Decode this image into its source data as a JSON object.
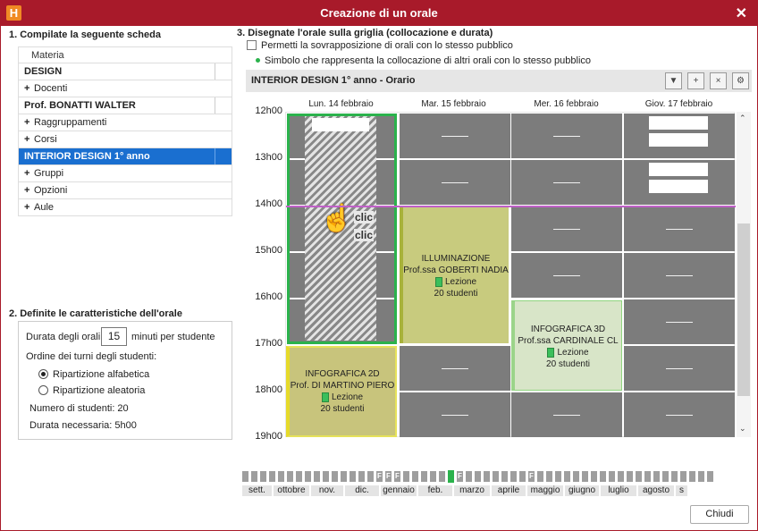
{
  "window": {
    "title": "Creazione di un orale",
    "app_icon": "H"
  },
  "section1": {
    "title": "1. Compilate la seguente scheda",
    "rows": [
      {
        "label": "Materia",
        "kind": "header"
      },
      {
        "label": "DESIGN",
        "kind": "value"
      },
      {
        "label": "Docenti",
        "kind": "group"
      },
      {
        "label": "Prof. BONATTI WALTER",
        "kind": "value"
      },
      {
        "label": "Raggruppamenti",
        "kind": "group"
      },
      {
        "label": "Corsi",
        "kind": "group"
      },
      {
        "label": "INTERIOR DESIGN  1° anno",
        "kind": "selected"
      },
      {
        "label": "Gruppi",
        "kind": "group"
      },
      {
        "label": "Opzioni",
        "kind": "group"
      },
      {
        "label": "Aule",
        "kind": "group"
      }
    ]
  },
  "section2": {
    "title": "2. Definite le caratteristiche dell'orale",
    "duration_label": "Durata degli orali:",
    "duration_value": "15",
    "duration_unit": "minuti per studente",
    "order_label": "Ordine dei turni degli studenti:",
    "option_alpha": "Ripartizione alfabetica",
    "option_random": "Ripartizione aleatoria",
    "students": "Numero di studenti: 20",
    "needed": "Durata necessaria: 5h00"
  },
  "section3": {
    "title": "3. Disegnate l'orale sulla griglia (collocazione e durata)",
    "overlap_label": "Permetti la sovrapposizione di orali con lo stesso pubblico",
    "symbol_label": "Simbolo che rappresenta la collocazione di altri orali con lo stesso pubblico"
  },
  "grid": {
    "title": "INTERIOR DESIGN  1° anno - Orario",
    "days": [
      "Lun. 14 febbraio",
      "Mar. 15 febbraio",
      "Mer. 16 febbraio",
      "Giov. 17 febbraio"
    ],
    "hours": [
      "12h00",
      "13h00",
      "14h00",
      "15h00",
      "16h00",
      "17h00",
      "18h00",
      "19h00"
    ],
    "click_text_1": "clic",
    "click_text_2": "clic",
    "lessons": [
      {
        "name": "ILLUMINAZIONE",
        "teacher": "Prof.ssa GOBERTI NADIA",
        "type": "Lezione",
        "students": "20 studenti"
      },
      {
        "name": "INFOGRAFICA 3D",
        "teacher": "Prof.ssa CARDINALE CL",
        "type": "Lezione",
        "students": "20 studenti"
      },
      {
        "name": "INFOGRAFICA 2D",
        "teacher": "Prof. DI MARTINO PIERO",
        "type": "Lezione",
        "students": "20 studenti"
      }
    ]
  },
  "timeline": {
    "flags": [
      {
        "week": 15,
        "label": "F"
      },
      {
        "week": 16,
        "label": "F"
      },
      {
        "week": 17,
        "label": "F"
      },
      {
        "week": 24,
        "label": "F"
      },
      {
        "week": 32,
        "label": "F"
      }
    ],
    "current_week": 23,
    "months": [
      "sett.",
      "ottobre",
      "nov.",
      "dic.",
      "gennaio",
      "feb.",
      "marzo",
      "aprile",
      "maggio",
      "giugno",
      "luglio",
      "agosto",
      "s"
    ]
  },
  "close_button": "Chiudi",
  "colors": {
    "titlebar": "#a81a2a",
    "selection": "#1a6fd0",
    "green": "#2bb24c",
    "lesson_yellow": "#c8cb7e",
    "lesson_light": "#d8e5c8"
  }
}
